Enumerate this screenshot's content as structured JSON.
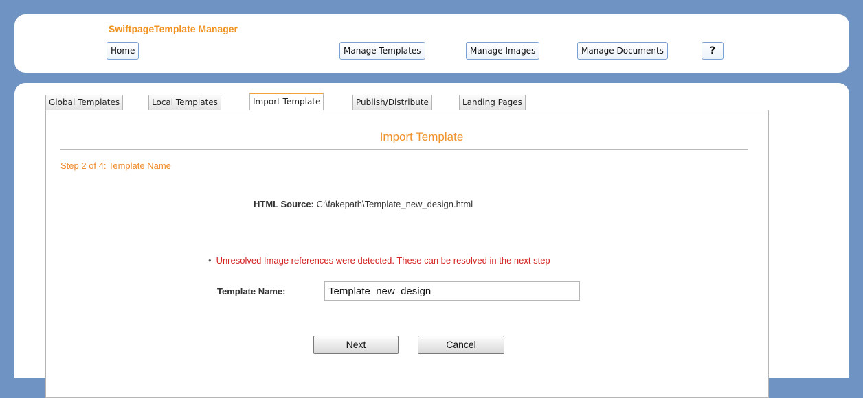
{
  "header": {
    "app_title": "SwiftpageTemplate Manager",
    "buttons": {
      "home": "Home",
      "manage_templates": "Manage Templates",
      "manage_images": "Manage Images",
      "manage_documents": "Manage Documents",
      "help": "?"
    }
  },
  "tabs": [
    {
      "label": "Global Templates",
      "active": false
    },
    {
      "label": "Local Templates",
      "active": false
    },
    {
      "label": "Import Template",
      "active": true
    },
    {
      "label": "Publish/Distribute",
      "active": false
    },
    {
      "label": "Landing Pages",
      "active": false
    }
  ],
  "main": {
    "section_title": "Import Template",
    "step_label": "Step 2 of 4: Template Name",
    "html_source": {
      "label": "HTML Source:",
      "value": "C:\\fakepath\\Template_new_design.html"
    },
    "warning": {
      "bullet": "•",
      "text": "Unresolved Image references were detected. These can be resolved in the next step"
    },
    "template_name": {
      "label": "Template Name:",
      "value": "Template_new_design"
    },
    "buttons": {
      "next": "Next",
      "cancel": "Cancel"
    }
  },
  "colors": {
    "background": "#6f93c3",
    "accent_orange": "#f0921f",
    "warning_red": "#d42222",
    "button_border_blue": "#7aa1d4"
  }
}
